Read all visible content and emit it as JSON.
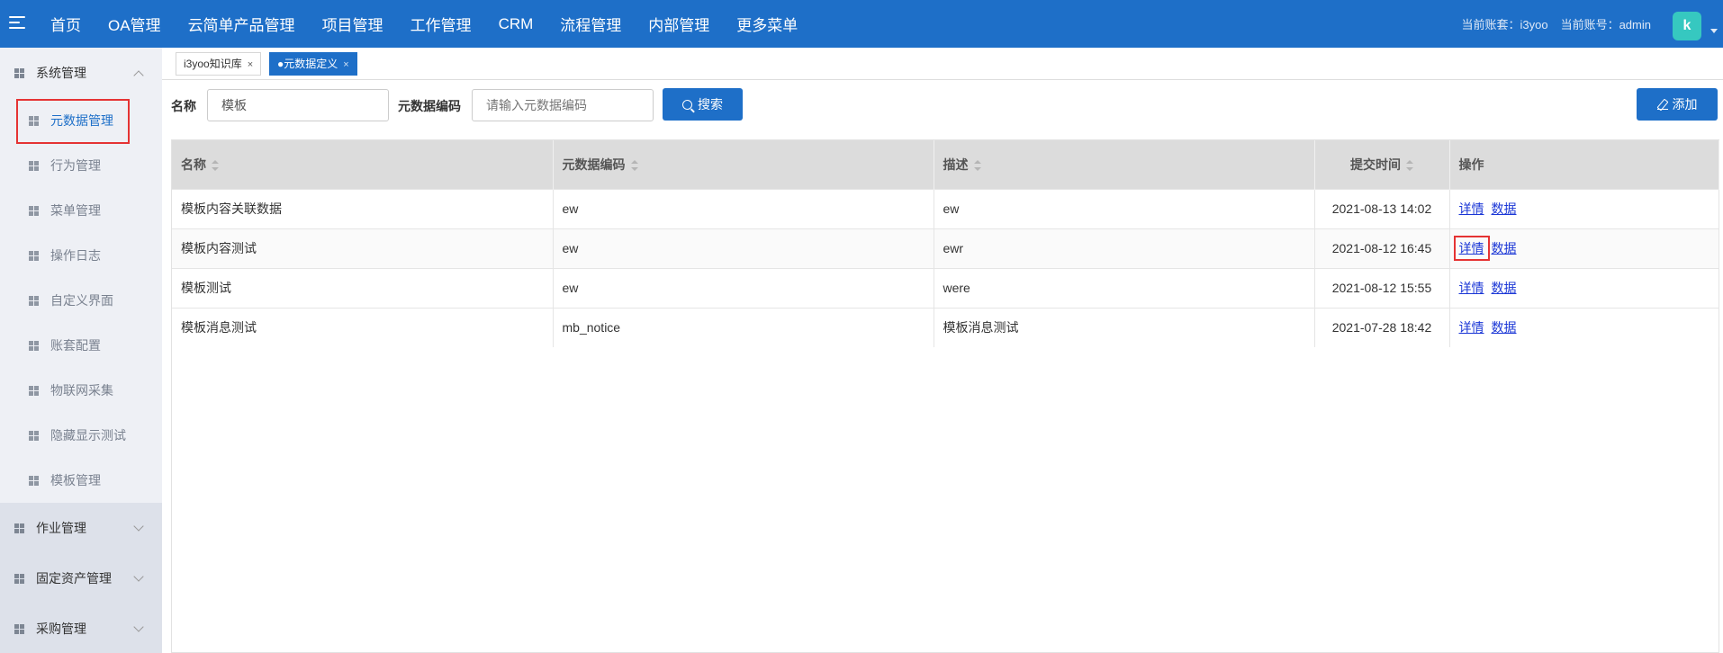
{
  "topbar": {
    "nav": [
      "首页",
      "OA管理",
      "云简单产品管理",
      "项目管理",
      "工作管理",
      "CRM",
      "流程管理",
      "内部管理",
      "更多菜单"
    ],
    "account_set": "当前账套：i3yoo",
    "account_user": "当前账号：admin",
    "avatar_letter": "k"
  },
  "sidebar": {
    "open_group": "系统管理",
    "items": [
      "元数据管理",
      "行为管理",
      "菜单管理",
      "操作日志",
      "自定义界面",
      "账套配置",
      "物联网采集",
      "隐藏显示测试",
      "模板管理"
    ],
    "groups": [
      "作业管理",
      "固定资产管理",
      "采购管理"
    ]
  },
  "tabs": [
    {
      "label": "i3yoo知识库",
      "close": "×"
    },
    {
      "label": "●元数据定义",
      "close": "×"
    }
  ],
  "search": {
    "name_label": "名称",
    "name_value": "模板",
    "code_label": "元数据编码",
    "code_placeholder": "请输入元数据编码",
    "search_button": "搜索",
    "add_button": "添加"
  },
  "table": {
    "headers": [
      "名称",
      "元数据编码",
      "描述",
      "提交时间",
      "操作"
    ],
    "rows": [
      {
        "name": "模板内容关联数据",
        "code": "ew",
        "desc": "ew",
        "time": "2021-08-13 14:02"
      },
      {
        "name": "模板内容测试",
        "code": "ew",
        "desc": "ewr",
        "time": "2021-08-12 16:45"
      },
      {
        "name": "模板测试",
        "code": "ew",
        "desc": "were",
        "time": "2021-08-12 15:55"
      },
      {
        "name": "模板消息测试",
        "code": "mb_notice",
        "desc": "模板消息测试",
        "time": "2021-07-28 18:42"
      }
    ],
    "action_detail": "详情",
    "action_data": "数据"
  }
}
